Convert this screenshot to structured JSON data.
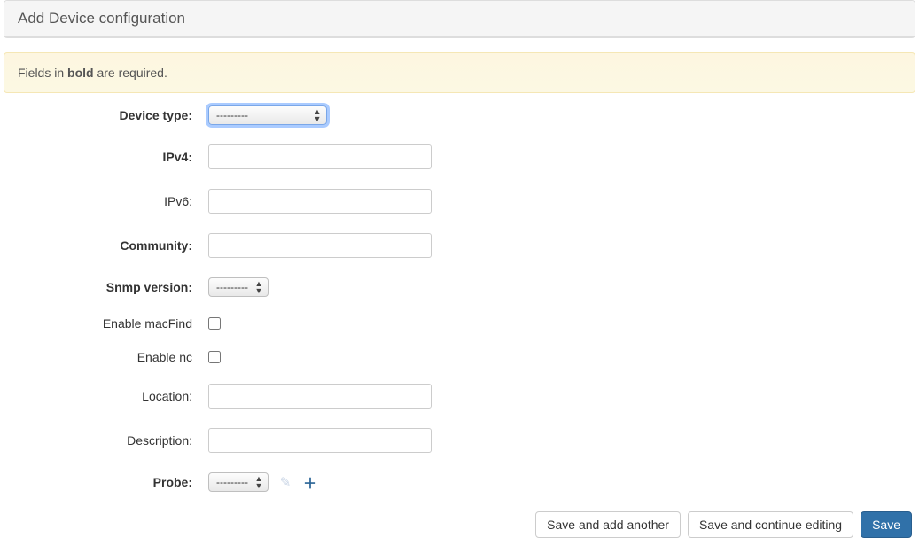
{
  "header": {
    "title": "Add Device configuration"
  },
  "alert": {
    "prefix": "Fields in ",
    "bold": "bold",
    "suffix": " are required."
  },
  "fields": {
    "device_type": {
      "label": "Device type:",
      "required": true,
      "selected": "---------"
    },
    "ipv4": {
      "label": "IPv4:",
      "required": true,
      "value": ""
    },
    "ipv6": {
      "label": "IPv6:",
      "required": false,
      "value": ""
    },
    "community": {
      "label": "Community:",
      "required": true,
      "value": ""
    },
    "snmp": {
      "label": "Snmp version:",
      "required": true,
      "selected": "---------"
    },
    "macfind": {
      "label": "Enable macFind",
      "required": false,
      "checked": false
    },
    "enable_nc": {
      "label": "Enable nc",
      "required": false,
      "checked": false
    },
    "location": {
      "label": "Location:",
      "required": false,
      "value": ""
    },
    "description": {
      "label": "Description:",
      "required": false,
      "value": ""
    },
    "probe": {
      "label": "Probe:",
      "required": true,
      "selected": "---------"
    }
  },
  "buttons": {
    "save_add_another": "Save and add another",
    "save_continue": "Save and continue editing",
    "save": "Save"
  }
}
